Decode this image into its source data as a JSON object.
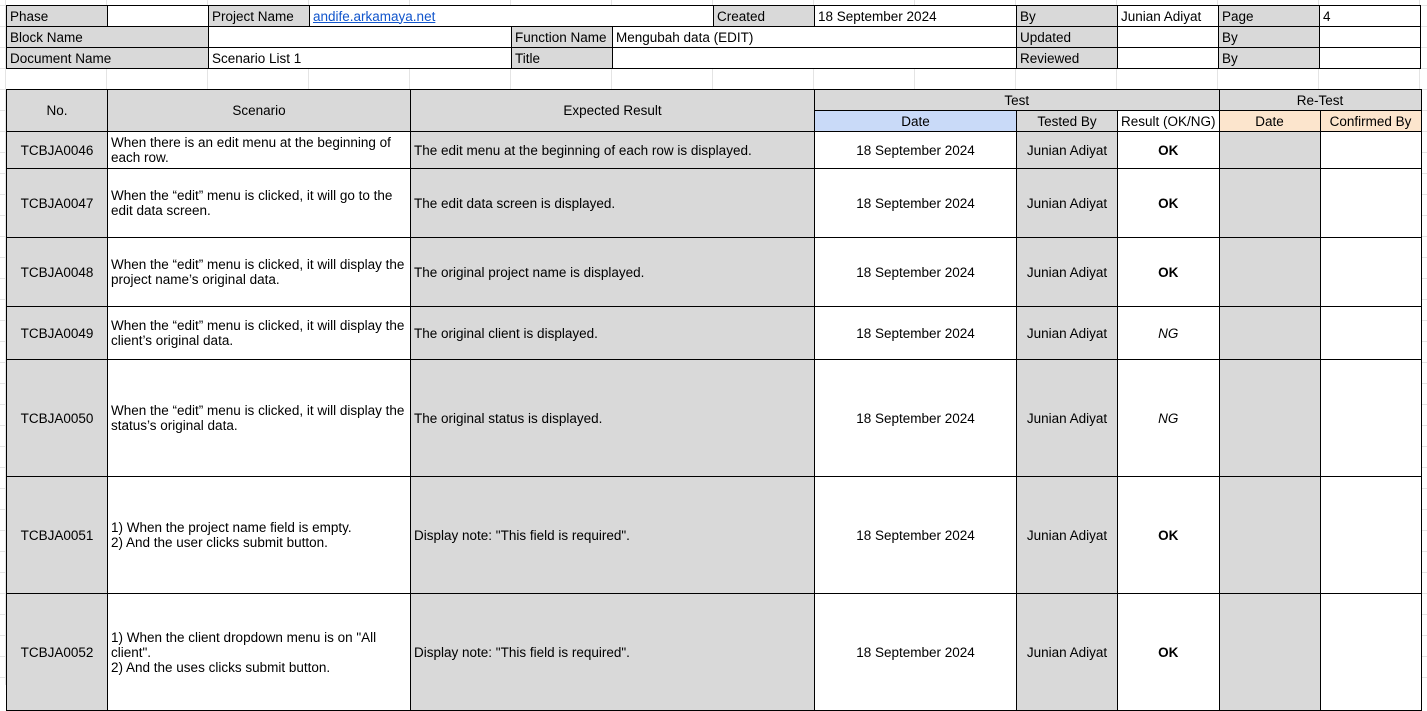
{
  "header": {
    "phase_label": "Phase",
    "phase_value": "",
    "project_name_label": "Project Name",
    "project_name_value": "andife.arkamaya.net",
    "created_label": "Created",
    "created_value": "18 September 2024",
    "by_label": "By",
    "by_value": "Junian Adiyat",
    "page_label": "Page",
    "page_value": "4",
    "block_name_label": "Block Name",
    "block_name_value": "",
    "function_name_label": "Function Name",
    "function_name_value": "Mengubah data (EDIT)",
    "updated_label": "Updated",
    "updated_value": "",
    "by2_label": "By",
    "by2_value": "",
    "document_name_label": "Document Name",
    "document_name_value": "Scenario List 1",
    "title_label": "Title",
    "title_value": "",
    "reviewed_label": "Reviewed",
    "reviewed_value": "",
    "by3_label": "By",
    "by3_value": ""
  },
  "columns": {
    "no": "No.",
    "scenario": "Scenario",
    "expected": "Expected Result",
    "test": "Test",
    "retest": "Re-Test",
    "test_date": "Date",
    "tested_by": "Tested By",
    "result": "Result (OK/NG)",
    "retest_date": "Date",
    "confirmed_by": "Confirmed By"
  },
  "rows": [
    {
      "no": "TCBJA0046",
      "scenario": "When there is an edit menu at the beginning of each row.",
      "expected": "The edit menu at the beginning of each row is displayed.",
      "date": "18 September 2024",
      "tested_by": "Junian Adiyat",
      "result": "OK",
      "retest_date": "",
      "confirmed_by": ""
    },
    {
      "no": "TCBJA0047",
      "scenario": "When the “edit” menu is clicked, it will go to the edit data screen.",
      "expected": "The edit data screen is displayed.",
      "date": "18 September 2024",
      "tested_by": "Junian Adiyat",
      "result": "OK",
      "retest_date": "",
      "confirmed_by": ""
    },
    {
      "no": "TCBJA0048",
      "scenario": "When the “edit” menu is clicked, it will display the project name’s original data.",
      "expected": "The original project name is displayed.",
      "date": "18 September 2024",
      "tested_by": "Junian Adiyat",
      "result": "OK",
      "retest_date": "",
      "confirmed_by": ""
    },
    {
      "no": "TCBJA0049",
      "scenario": "When the “edit” menu is clicked, it will display the client’s original data.",
      "expected": "The original client is displayed.",
      "date": "18 September 2024",
      "tested_by": "Junian Adiyat",
      "result": "NG",
      "retest_date": "",
      "confirmed_by": ""
    },
    {
      "no": "TCBJA0050",
      "scenario": "When the “edit” menu is clicked, it will display the status’s original data.",
      "expected": "The original status is displayed.",
      "date": "18 September 2024",
      "tested_by": "Junian Adiyat",
      "result": "NG",
      "retest_date": "",
      "confirmed_by": ""
    },
    {
      "no": "TCBJA0051",
      "scenario": "1) When the project name field is empty.\n2) And the user clicks submit button.",
      "expected": "Display note: \"This field is required\".",
      "date": "18 September 2024",
      "tested_by": "Junian Adiyat",
      "result": "OK",
      "retest_date": "",
      "confirmed_by": ""
    },
    {
      "no": "TCBJA0052",
      "scenario": "1) When the client dropdown menu is on \"All client\".\n2) And the uses clicks submit button.",
      "expected": "Display note: \"This field is required\".",
      "date": "18 September 2024",
      "tested_by": "Junian Adiyat",
      "result": "OK",
      "retest_date": "",
      "confirmed_by": ""
    }
  ]
}
